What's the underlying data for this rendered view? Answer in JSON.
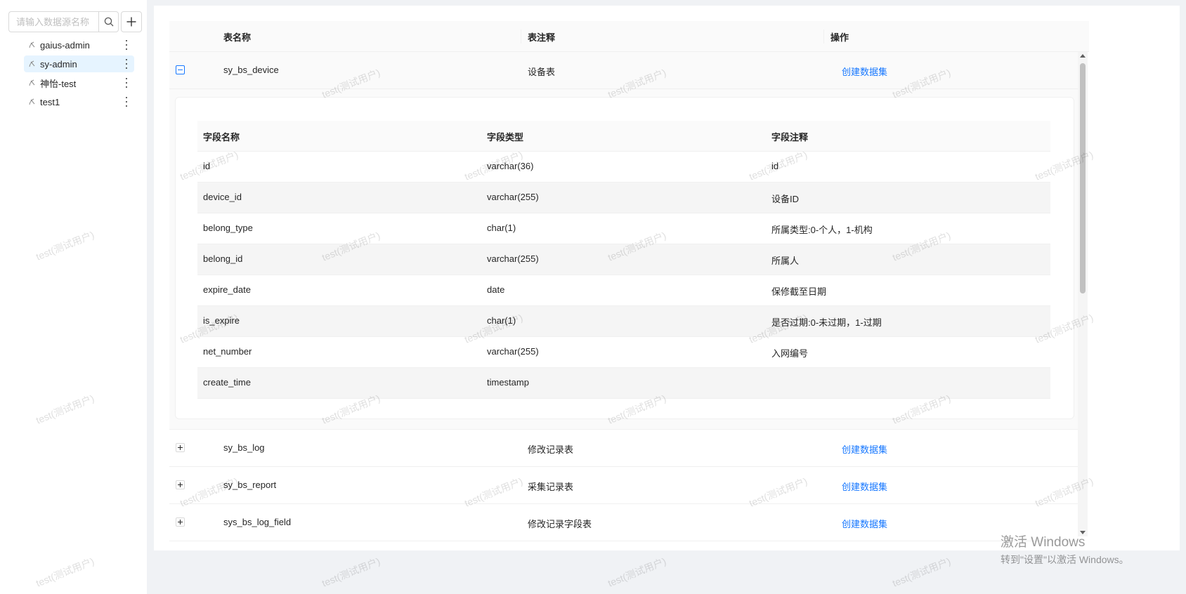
{
  "sidebar": {
    "search": {
      "placeholder": "请输入数据源名称"
    },
    "items": [
      {
        "label": "gaius-admin",
        "selected": false
      },
      {
        "label": "sy-admin",
        "selected": true
      },
      {
        "label": "神怡-test",
        "selected": false
      },
      {
        "label": "test1",
        "selected": false
      }
    ]
  },
  "outer_table": {
    "columns": [
      "表名称",
      "表注释",
      "操作"
    ],
    "rows": [
      {
        "name": "sy_bs_device",
        "comment": "设备表",
        "action": "创建数据集",
        "expanded": true
      },
      {
        "name": "sy_bs_log",
        "comment": "修改记录表",
        "action": "创建数据集",
        "expanded": false
      },
      {
        "name": "sy_bs_report",
        "comment": "采集记录表",
        "action": "创建数据集",
        "expanded": false
      },
      {
        "name": "sys_bs_log_field",
        "comment": "修改记录字段表",
        "action": "创建数据集",
        "expanded": false
      }
    ]
  },
  "inner_table": {
    "columns": [
      "字段名称",
      "字段类型",
      "字段注释"
    ],
    "rows": [
      [
        "id",
        "varchar(36)",
        "id"
      ],
      [
        "device_id",
        "varchar(255)",
        "设备ID"
      ],
      [
        "belong_type",
        "char(1)",
        "所属类型:0-个人，1-机构"
      ],
      [
        "belong_id",
        "varchar(255)",
        "所属人"
      ],
      [
        "expire_date",
        "date",
        "保修截至日期"
      ],
      [
        "is_expire",
        "char(1)",
        "是否过期:0-未过期，1-过期"
      ],
      [
        "net_number",
        "varchar(255)",
        "入网编号"
      ],
      [
        "create_time",
        "timestamp",
        ""
      ]
    ]
  },
  "watermark": {
    "text": "test(测试用户)"
  },
  "windows_activation": {
    "title": "激活 Windows",
    "subtitle": "转到\"设置\"以激活 Windows。"
  },
  "colors": {
    "accent": "#1677ff",
    "selected_bg": "#e6f4ff",
    "page_bg": "#f0f2f5"
  }
}
